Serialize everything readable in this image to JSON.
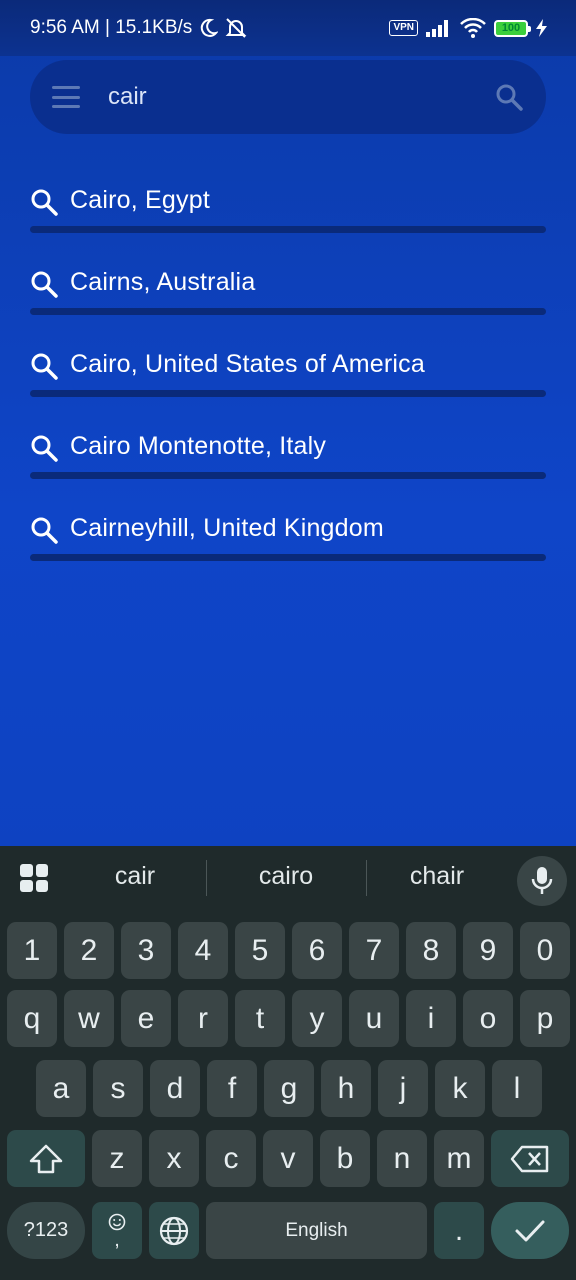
{
  "status_bar": {
    "time_speed": "9:56 AM | 15.1KB/s",
    "vpn": "VPN",
    "battery": "100",
    "icons": [
      "moon-icon",
      "alarm-off-icon",
      "signal-icon",
      "wifi-icon",
      "battery-icon",
      "charging-icon"
    ]
  },
  "search": {
    "value": "cair",
    "menu_icon": "menu-icon",
    "search_icon": "search-icon"
  },
  "results": [
    {
      "label": "Cairo, Egypt"
    },
    {
      "label": "Cairns, Australia"
    },
    {
      "label": "Cairo, United States of America"
    },
    {
      "label": "Cairo Montenotte, Italy"
    },
    {
      "label": "Cairneyhill, United Kingdom"
    }
  ],
  "keyboard": {
    "suggestions": [
      "cair",
      "cairo",
      "chair"
    ],
    "row_numbers": [
      "1",
      "2",
      "3",
      "4",
      "5",
      "6",
      "7",
      "8",
      "9",
      "0"
    ],
    "row1": [
      "q",
      "w",
      "e",
      "r",
      "t",
      "y",
      "u",
      "i",
      "o",
      "p"
    ],
    "row2": [
      "a",
      "s",
      "d",
      "f",
      "g",
      "h",
      "j",
      "k",
      "l"
    ],
    "row3": [
      "z",
      "x",
      "c",
      "v",
      "b",
      "n",
      "m"
    ],
    "mode_key": "?123",
    "emoji_key_sub": ",",
    "space_label": "English",
    "period_key": ".",
    "colors": {
      "background": "#1f2a2b",
      "key": "#3a4546",
      "special": "#2d4a4a"
    }
  }
}
